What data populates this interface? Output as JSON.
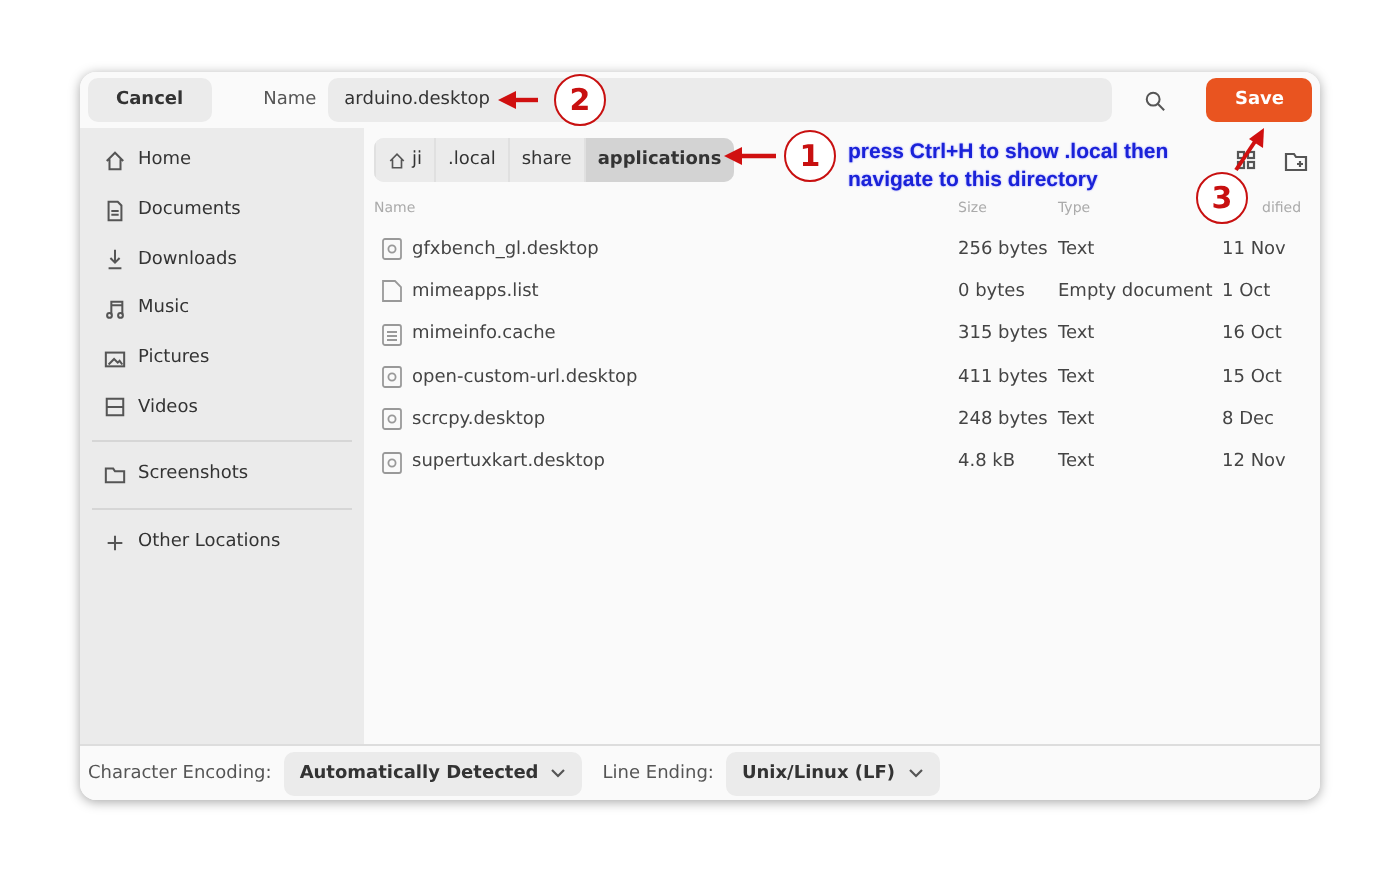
{
  "header": {
    "cancel": "Cancel",
    "name_label": "Name",
    "name_value": "arduino.desktop",
    "save": "Save"
  },
  "sidebar": {
    "sections": [
      [
        {
          "label": "Home",
          "kind": "home"
        },
        {
          "label": "Documents",
          "kind": "document"
        },
        {
          "label": "Downloads",
          "kind": "download"
        },
        {
          "label": "Music",
          "kind": "music"
        },
        {
          "label": "Pictures",
          "kind": "picture"
        },
        {
          "label": "Videos",
          "kind": "video"
        }
      ],
      [
        {
          "label": "Screenshots",
          "kind": "folder"
        }
      ],
      [
        {
          "label": "Other Locations",
          "kind": "plus"
        }
      ]
    ]
  },
  "path": [
    {
      "label": "ji",
      "home": true,
      "selected": false
    },
    {
      "label": ".local",
      "home": false,
      "selected": false
    },
    {
      "label": "share",
      "home": false,
      "selected": false
    },
    {
      "label": "applications",
      "home": false,
      "selected": true
    }
  ],
  "table": {
    "columns": [
      "Name",
      "Size",
      "Type",
      "dified"
    ],
    "rows": [
      {
        "kind": "desktop",
        "name": "gfxbench_gl.desktop",
        "size": "256 bytes",
        "type": "Text",
        "modified": "11 Nov"
      },
      {
        "kind": "blank",
        "name": "mimeapps.list",
        "size": "0 bytes",
        "type": "Empty document",
        "modified": "1 Oct"
      },
      {
        "kind": "text",
        "name": "mimeinfo.cache",
        "size": "315 bytes",
        "type": "Text",
        "modified": "16 Oct"
      },
      {
        "kind": "desktop",
        "name": "open-custom-url.desktop",
        "size": "411 bytes",
        "type": "Text",
        "modified": "15 Oct"
      },
      {
        "kind": "desktop",
        "name": "scrcpy.desktop",
        "size": "248 bytes",
        "type": "Text",
        "modified": "8 Dec"
      },
      {
        "kind": "desktop",
        "name": "supertuxkart.desktop",
        "size": "4.8 kB",
        "type": "Text",
        "modified": "12 Nov"
      }
    ]
  },
  "footer": {
    "encoding_label": "Character Encoding:",
    "encoding_value": "Automatically Detected",
    "ending_label": "Line Ending:",
    "ending_value": "Unix/Linux (LF)"
  },
  "annotations": {
    "step_1": "1",
    "step_2": "2",
    "step_3": "3",
    "note": "press Ctrl+H to show .local then navigate to this directory"
  }
}
